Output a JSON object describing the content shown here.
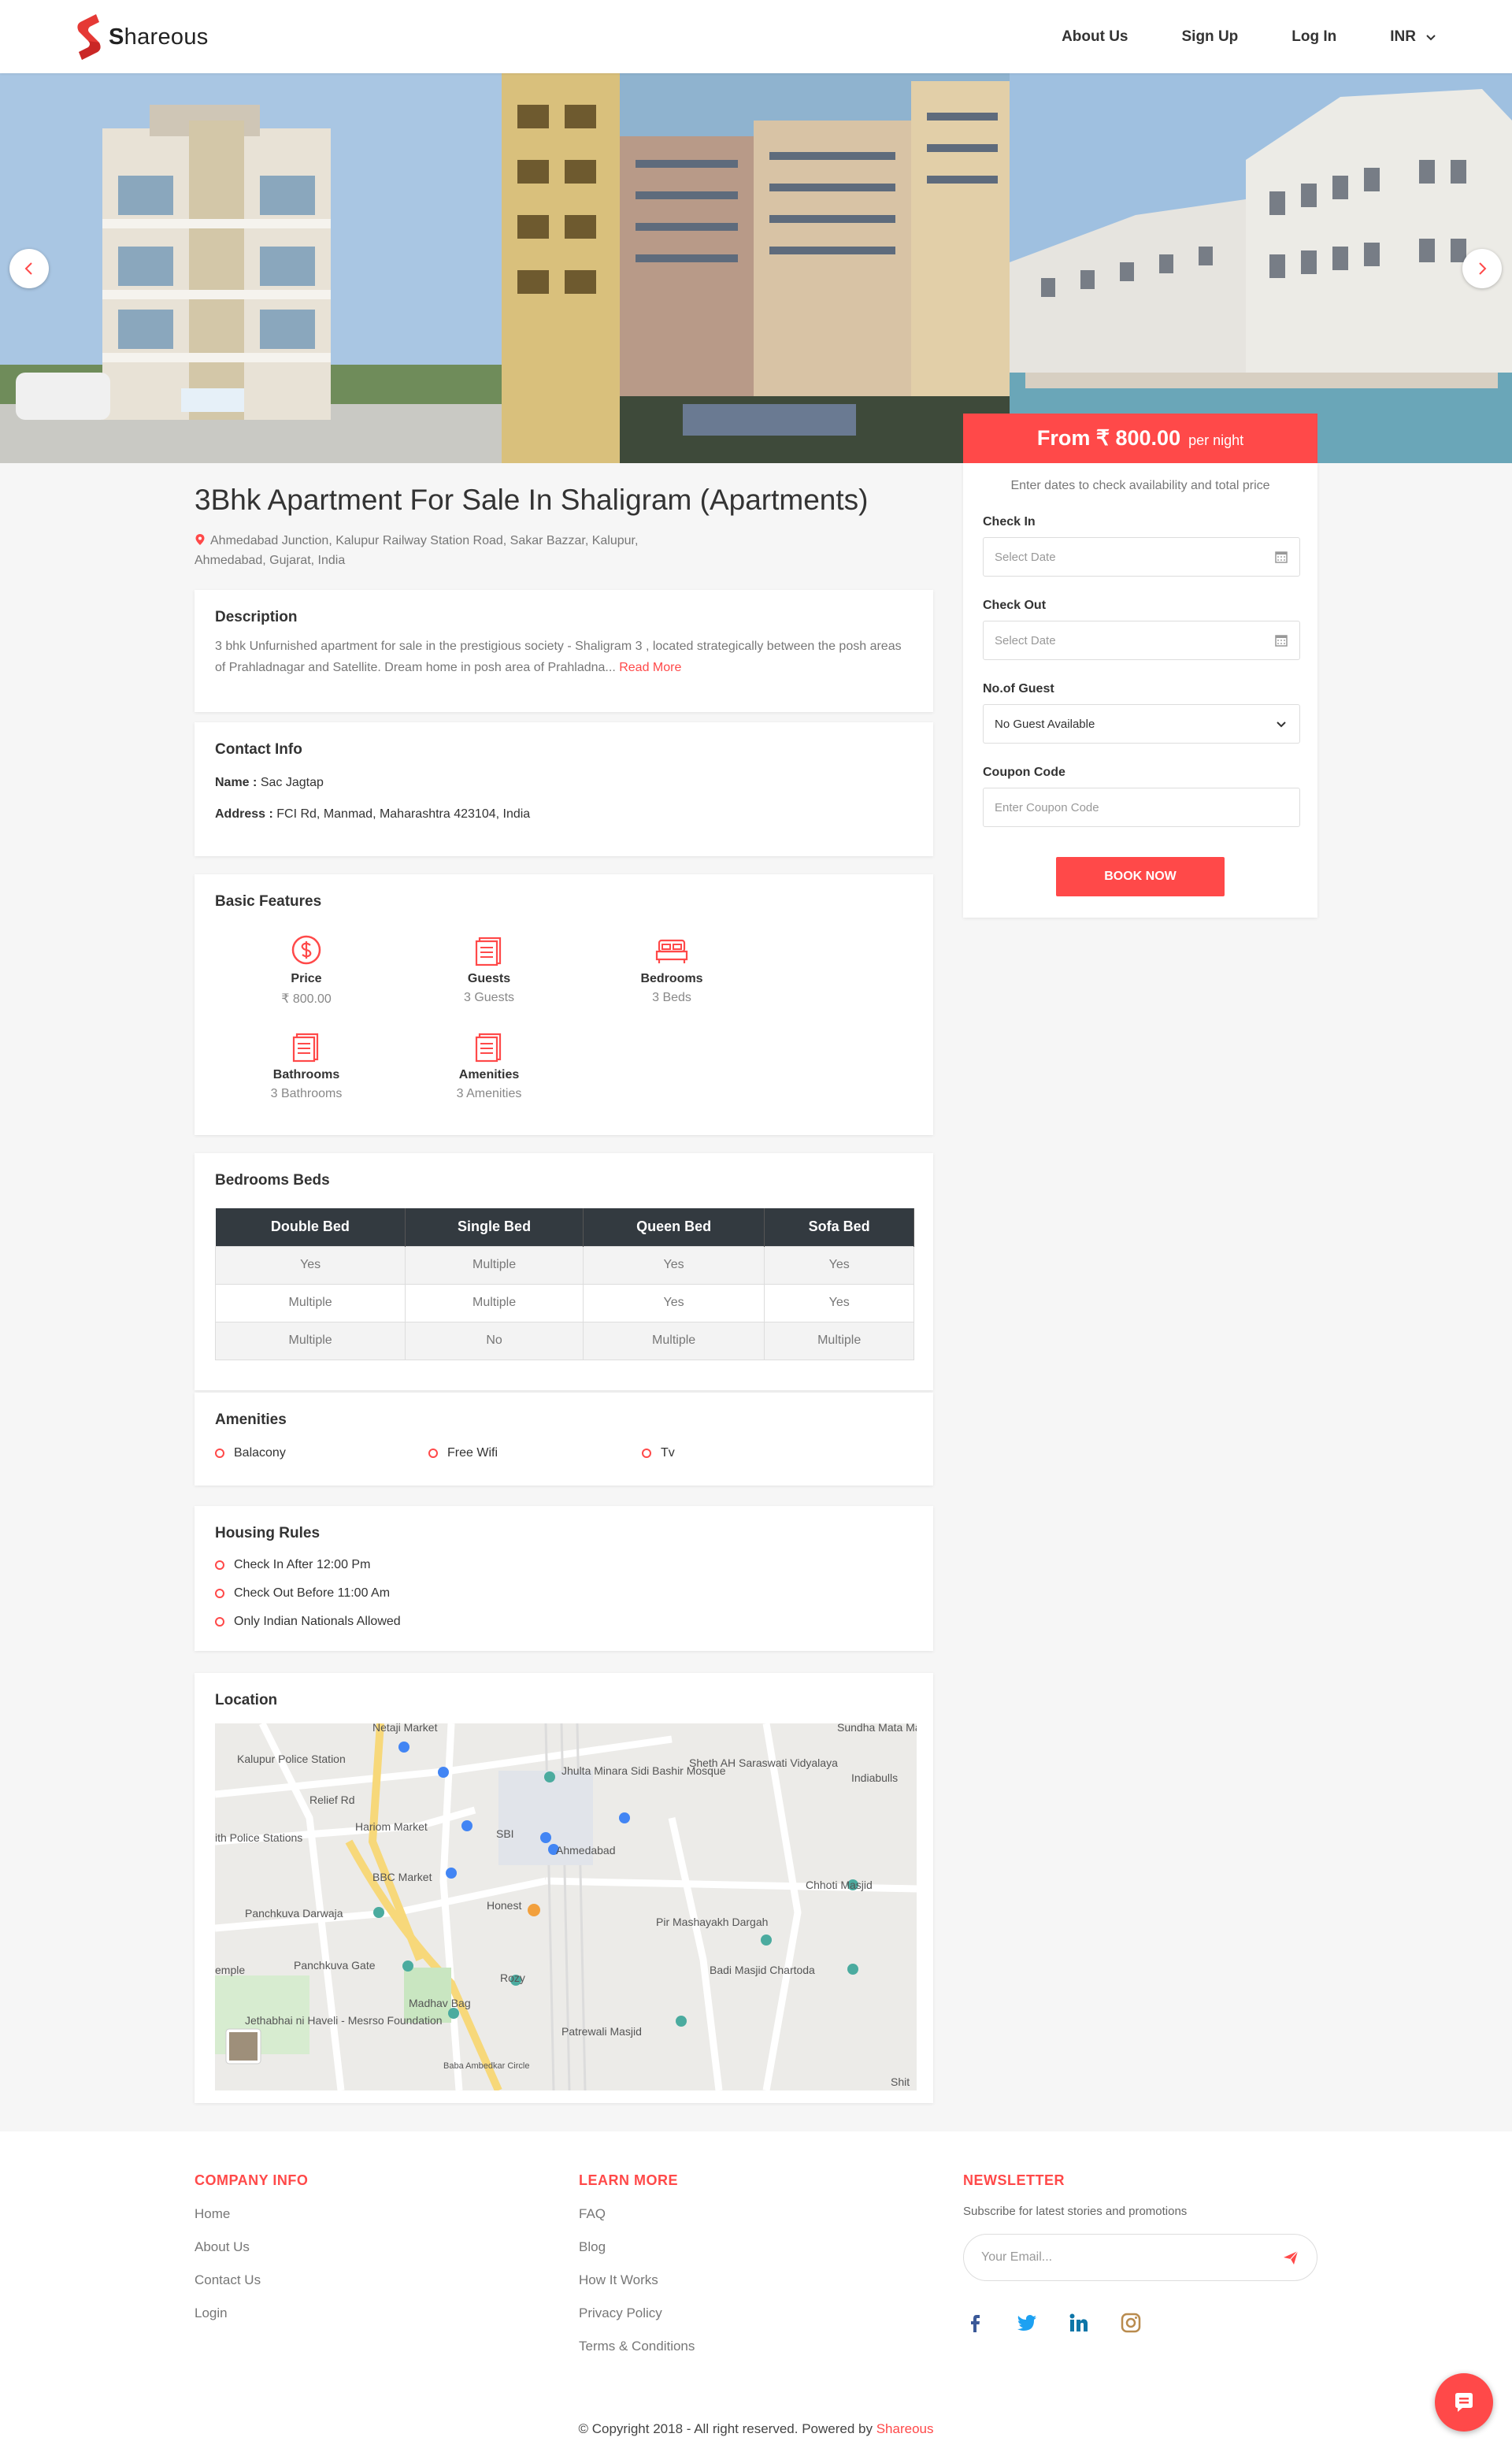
{
  "brand": {
    "name": "hareous"
  },
  "nav": {
    "about": "About Us",
    "signup": "Sign Up",
    "login": "Log In",
    "currency": "INR"
  },
  "listing": {
    "title": "3Bhk Apartment For Sale In Shaligram (Apartments)",
    "address": "Ahmedabad Junction, Kalupur Railway Station Road, Sakar Bazzar, Kalupur, Ahmedabad, Gujarat, India"
  },
  "description": {
    "heading": "Description",
    "text": "3 bhk Unfurnished apartment for sale in the prestigious society - Shaligram 3 , located strategically between the posh areas of Prahladnagar and Satellite. Dream home in posh area of Prahladna...",
    "read_more": "Read More"
  },
  "contact": {
    "heading": "Contact Info",
    "name_label": "Name :",
    "name": "Sac Jagtap",
    "address_label": "Address :",
    "address": "FCI Rd, Manmad, Maharashtra 423104, India"
  },
  "features": {
    "heading": "Basic Features",
    "items": [
      {
        "name": "Price",
        "value": "₹ 800.00",
        "icon": "dollar-icon"
      },
      {
        "name": "Guests",
        "value": "3 Guests",
        "icon": "document-icon"
      },
      {
        "name": "Bedrooms",
        "value": "3 Beds",
        "icon": "bed-icon"
      },
      {
        "name": "Bathrooms",
        "value": "3 Bathrooms",
        "icon": "document-icon"
      },
      {
        "name": "Amenities",
        "value": "3 Amenities",
        "icon": "document-icon"
      }
    ]
  },
  "beds": {
    "heading": "Bedrooms Beds",
    "columns": [
      "Double Bed",
      "Single Bed",
      "Queen Bed",
      "Sofa Bed"
    ],
    "rows": [
      [
        "Yes",
        "Multiple",
        "Yes",
        "Yes"
      ],
      [
        "Multiple",
        "Multiple",
        "Yes",
        "Yes"
      ],
      [
        "Multiple",
        "No",
        "Multiple",
        "Multiple"
      ]
    ]
  },
  "amenities": {
    "heading": "Amenities",
    "items": [
      "Balacony",
      "Free Wifi",
      "Tv"
    ]
  },
  "rules": {
    "heading": "Housing Rules",
    "items": [
      "Check In After 12:00 Pm",
      "Check Out Before 11:00 Am",
      "Only Indian Nationals Allowed"
    ]
  },
  "location": {
    "heading": "Location",
    "map_labels": [
      "Kalupur Police Station",
      "Relief Rd",
      "Hariom Market",
      "ith Police Stations",
      "SBI",
      "Jhulta Minara Sidi Bashir Mosque",
      "Sheth AH Saraswati Vidyalaya",
      "Indiabulls",
      "Ahmedabad",
      "BBC Market",
      "Panchkuva Darwaja",
      "Honest",
      "Chhoti Masjid",
      "Pir Mashayakh Dargah",
      "Panchkuva Gate",
      "Badi Masjid Chartoda",
      "Rozy",
      "Madhav Bag",
      "Jethabhai ni Haveli - Mesrso Foundation",
      "Patrewali Masjid",
      "Baba Ambedkar Circle",
      "Netaji Market",
      "Sundha Mata Mandir",
      "Shit",
      "emple"
    ]
  },
  "booking": {
    "price": "From ₹ 800.00",
    "per": "per night",
    "hint": "Enter dates to check availability and total price",
    "checkin_label": "Check In",
    "checkin_placeholder": "Select Date",
    "checkout_label": "Check Out",
    "checkout_placeholder": "Select Date",
    "guests_label": "No.of Guest",
    "guests_value": "No Guest Available",
    "coupon_label": "Coupon Code",
    "coupon_placeholder": "Enter Coupon Code",
    "book_label": "BOOK NOW"
  },
  "footer": {
    "company": {
      "heading": "COMPANY INFO",
      "links": [
        "Home",
        "About Us",
        "Contact Us",
        "Login"
      ]
    },
    "learn": {
      "heading": "LEARN MORE",
      "links": [
        "FAQ",
        "Blog",
        "How It Works",
        "Privacy Policy",
        "Terms & Conditions"
      ]
    },
    "newsletter": {
      "heading": "NEWSLETTER",
      "sub": "Subscribe for latest stories and promotions",
      "placeholder": "Your Email..."
    },
    "social": [
      "facebook-icon",
      "twitter-icon",
      "linkedin-icon",
      "instagram-icon"
    ],
    "copyright": "© Copyright 2018 - All right reserved. Powered by",
    "powered_brand": "Shareous"
  },
  "colors": {
    "accent": "#ff4949",
    "table_header": "#333a40"
  }
}
